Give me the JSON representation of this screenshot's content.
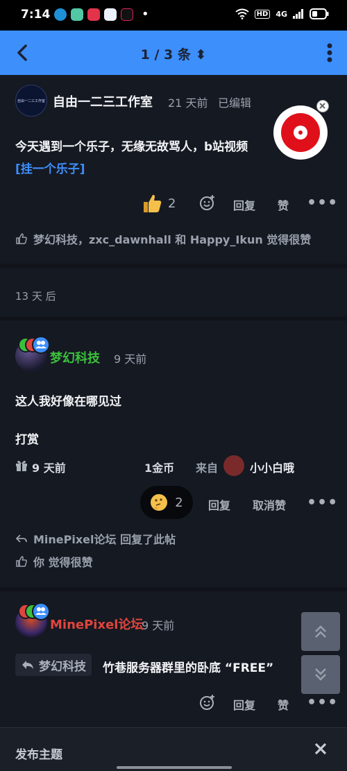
{
  "status_bar": {
    "time": "7:14",
    "dot": "•",
    "hd": "HD",
    "network": "4G"
  },
  "topbar": {
    "title": "1 / 3 条 ⬍"
  },
  "post1": {
    "author": "自由一二三工作室",
    "time": "21 天前",
    "edited": "已编辑",
    "avatar_text": "自由一二三工作室",
    "text": "今天遇到一个乐子，无缘无故骂人，b站视频",
    "link": "[挂一个乐子]",
    "like_count": "2",
    "reply": "回复",
    "like": "赞",
    "more": "•••",
    "likes_line": "梦幻科技，zxc_dawnhall 和 Happy_Ikun 觉得很赞"
  },
  "gap": {
    "label": "13 天 后"
  },
  "post2": {
    "author": "梦幻科技",
    "time": "9 天前",
    "text": "这人我好像在哪见过",
    "tip_title": "打赏",
    "tip_time": "9 天前",
    "tip_amount": "1金币",
    "tip_from": "来自",
    "tip_user": "小小白哦",
    "reaction_count": "2",
    "reply": "回复",
    "unlike": "取消赞",
    "more": "•••",
    "replied_line": "MinePixel论坛 回复了此帖",
    "liked_line": "你 觉得很赞"
  },
  "post3": {
    "author": "MinePixel论坛",
    "time": "9 天前",
    "quote_user": "梦幻科技",
    "text": "竹巷服务器群里的卧底 “FREE”",
    "reply": "回复",
    "like": "赞",
    "more": "•••"
  },
  "bottom": {
    "label": "发布主题"
  },
  "colors": {
    "accent": "#3d8ffb",
    "green_name": "#3bbf3b",
    "red_name": "#e0453d",
    "bg": "#151922"
  }
}
